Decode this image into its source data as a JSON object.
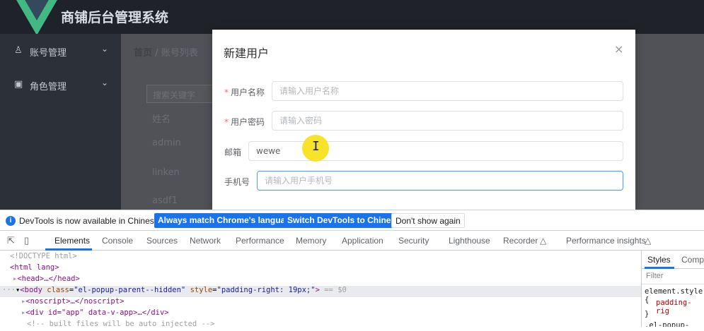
{
  "app": {
    "title": "商铺后台管理系统",
    "sidebar": [
      {
        "label": "账号管理",
        "icon": "user-icon"
      },
      {
        "label": "角色管理",
        "icon": "role-icon"
      }
    ],
    "breadcrumb": {
      "home": "首页",
      "separator": "/",
      "current": "账号列表"
    },
    "search_placeholder": "搜索关键字",
    "table": {
      "header": "姓名",
      "rows": [
        "admin",
        "linken",
        "asdf1"
      ]
    }
  },
  "dialog": {
    "title": "新建用户",
    "close": "×",
    "fields": [
      {
        "required": true,
        "label": "用户名称",
        "placeholder": "请输入用户名称",
        "value": ""
      },
      {
        "required": true,
        "label": "用户密码",
        "placeholder": "请输入密码",
        "value": ""
      },
      {
        "required": false,
        "label": "邮箱",
        "placeholder": "",
        "value": "wewe"
      },
      {
        "required": false,
        "label": "手机号",
        "placeholder": "请输入用户手机号",
        "value": ""
      }
    ],
    "required_mark": "*"
  },
  "devtools": {
    "notice": {
      "message": "DevTools is now available in Chinese!",
      "btn_match": "Always match Chrome's language",
      "btn_switch": "Switch DevTools to Chinese",
      "btn_dismiss": "Don't show again"
    },
    "tabs": [
      "Elements",
      "Console",
      "Sources",
      "Network",
      "Performance",
      "Memory",
      "Application",
      "Security",
      "Lighthouse",
      "Recorder",
      "Performance insights"
    ],
    "elements": {
      "doctype": "<!DOCTYPE html>",
      "html_open": "<html lang>",
      "head": "<head>…</head>",
      "body_tag": "body",
      "body_class_name": "class",
      "body_class_value": "\"el-popup-parent--hidden\"",
      "body_style_name": "style",
      "body_style_value": "\"padding-right: 19px;\"",
      "body_marker": "== $0",
      "noscript": "<noscript>…</noscript>",
      "div_app_tag": "<div id=\"app\" data-v-app>…</div>",
      "comment": "<!-- built files will be auto injected -->"
    },
    "styles": {
      "tab_styles": "Styles",
      "tab_computed": "Comp",
      "filter": "Filter",
      "rule": "element.style {",
      "prop": "padding-rig",
      "close": "}",
      "next": ".el-popup-pare"
    }
  },
  "colors": {
    "accent": "#1a73e8",
    "vue_green": "#42b883",
    "dark_green": "#35495e",
    "modal_focus": "#409eff"
  }
}
